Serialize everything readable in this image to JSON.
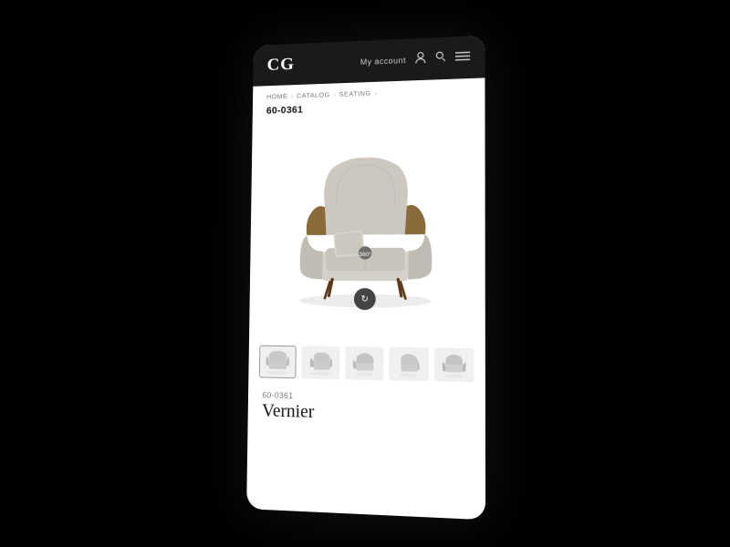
{
  "header": {
    "logo": "CG",
    "my_account_label": "My account",
    "icons": {
      "user": "👤",
      "search": "🔍",
      "menu": "☰"
    }
  },
  "breadcrumb": {
    "items": [
      {
        "label": "HOME",
        "active": false
      },
      {
        "label": "CATALOG",
        "active": false
      },
      {
        "label": "SEATING",
        "active": true
      }
    ],
    "separator": "›"
  },
  "product": {
    "id": "60-0361",
    "sku": "60-0361",
    "name": "Vernier",
    "thumbnails": [
      "thumb-front",
      "thumb-side",
      "thumb-angle",
      "thumb-quarter",
      "thumb-back"
    ]
  }
}
